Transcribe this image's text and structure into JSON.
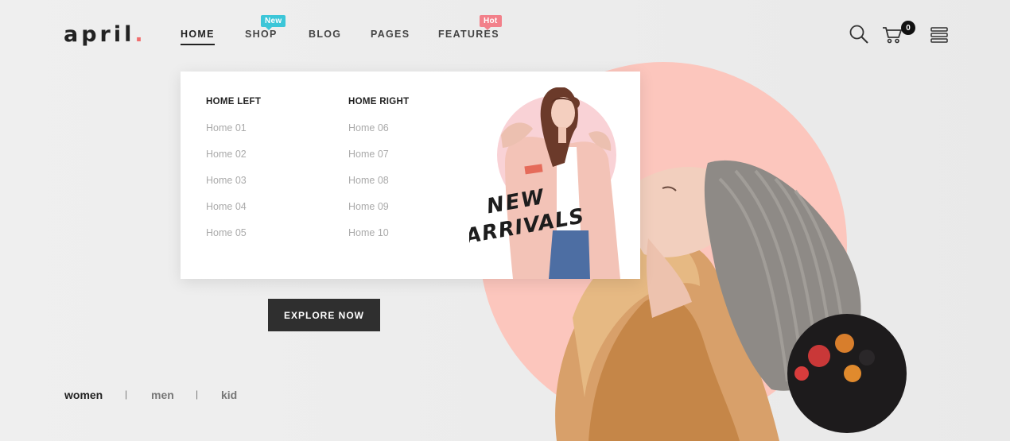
{
  "brand": {
    "name": "april",
    "dot": ".",
    "accent": "#f06e6e"
  },
  "nav": {
    "items": [
      {
        "label": "HOME",
        "active": true
      },
      {
        "label": "SHOP",
        "badge": "New",
        "badge_color": "#3cc6d8"
      },
      {
        "label": "BLOG"
      },
      {
        "label": "PAGES"
      },
      {
        "label": "FEATURES",
        "badge": "Hot",
        "badge_color": "#f2808a"
      }
    ]
  },
  "header_icons": {
    "search": "search-icon",
    "cart": "cart-icon",
    "cart_count": "0",
    "menu": "menu-icon"
  },
  "mega_menu": {
    "columns": [
      {
        "title": "HOME LEFT",
        "links": [
          "Home 01",
          "Home 02",
          "Home 03",
          "Home 04",
          "Home 05"
        ]
      },
      {
        "title": "HOME RIGHT",
        "links": [
          "Home 06",
          "Home 07",
          "Home 08",
          "Home 09",
          "Home 10"
        ]
      }
    ],
    "promo_text": [
      "NEW",
      "ARRIVALS"
    ],
    "promo_circle_color": "#f9d2d6"
  },
  "hero": {
    "cta_label": "EXPLORE NOW",
    "circle_color": "#fcc6bd"
  },
  "categories": {
    "items": [
      "women",
      "men",
      "kid"
    ],
    "separator": "|"
  }
}
